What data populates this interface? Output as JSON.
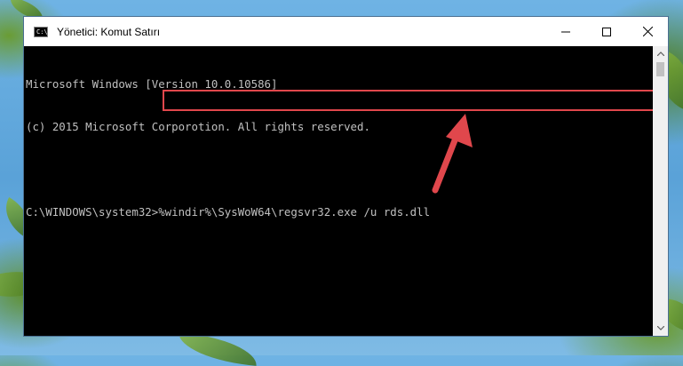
{
  "window": {
    "title": "Yönetici: Komut Satırı",
    "app_icon_glyph": "C:\\"
  },
  "title_buttons": {
    "minimize_icon": "minimize-icon",
    "maximize_icon": "maximize-icon",
    "close_icon": "close-icon"
  },
  "console": {
    "lines": [
      "Microsoft Windows [Version 10.0.10586]",
      "(c) 2015 Microsoft Corporotion. All rights reserved.",
      "",
      "C:\\WINDOWS\\system32>%windir%\\SysWoW64\\regsvr32.exe /u rds.dll"
    ]
  },
  "colors": {
    "console_bg": "#000000",
    "console_text": "#c0c0c0",
    "highlight": "#e0474c",
    "arrow": "#e0474c"
  }
}
